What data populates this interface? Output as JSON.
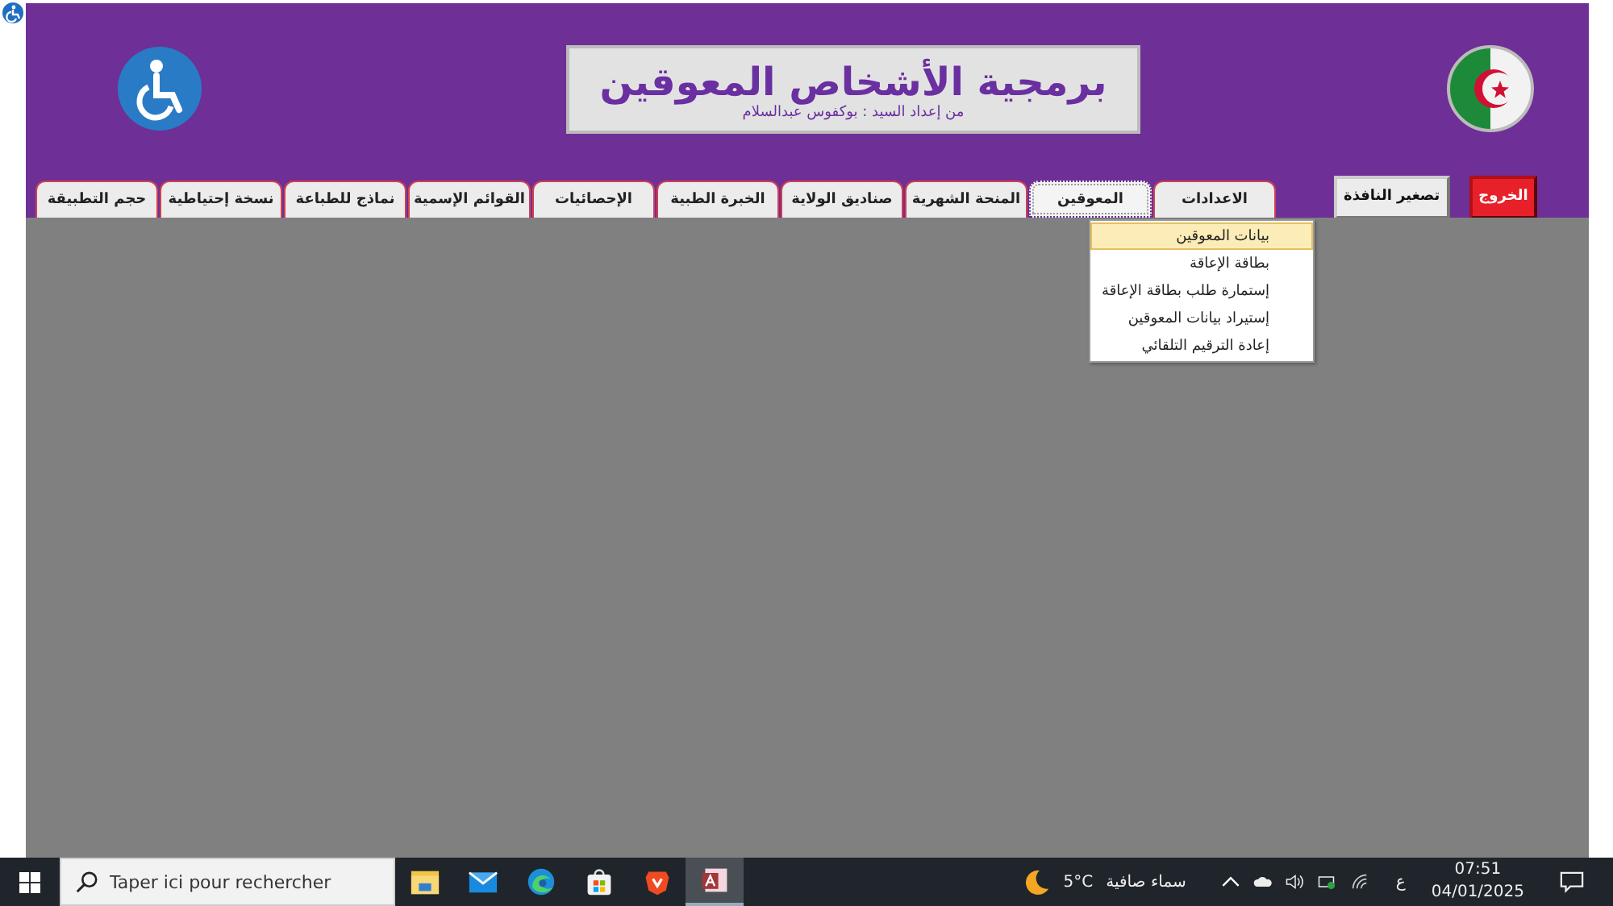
{
  "header": {
    "title": "برمجية الأشخاص المعوقين",
    "subtitle": "من إعداد السيد : بوكفوس عبدالسلام"
  },
  "buttons": [
    {
      "label": "الخروج",
      "kind": "exit"
    },
    {
      "label": "تصغير النافذة",
      "kind": "minimize"
    }
  ],
  "tabs": [
    {
      "label": "الاعدادات",
      "selected": false
    },
    {
      "label": "المعوقين",
      "selected": true
    },
    {
      "label": "المنحة الشهرية",
      "selected": false
    },
    {
      "label": "صناديق الولاية",
      "selected": false
    },
    {
      "label": "الخبرة الطبية",
      "selected": false
    },
    {
      "label": "الإحصائيات",
      "selected": false
    },
    {
      "label": "القوائم الإسمية",
      "selected": false
    },
    {
      "label": "نماذج للطباعة",
      "selected": false
    },
    {
      "label": "نسخة إحتياطية",
      "selected": false
    },
    {
      "label": "حجم  التطبيقة",
      "selected": false
    }
  ],
  "menu": {
    "items": [
      {
        "label": "بيانات المعوقين",
        "selected": true
      },
      {
        "label": "بطاقة الإعاقة",
        "selected": false
      },
      {
        "label": "إستمارة طلب بطاقة الإعاقة",
        "selected": false
      },
      {
        "label": "إستيراد بيانات المعوقين",
        "selected": false
      },
      {
        "label": "إعادة الترقيم التلقائي",
        "selected": false
      }
    ]
  },
  "taskbar": {
    "search": {
      "placeholder": "Taper ici pour rechercher"
    },
    "weather": {
      "temperature": "5°C",
      "condition": "سماء صافية"
    },
    "language": "ع",
    "time": "07:51",
    "date": "04/01/2025"
  }
}
